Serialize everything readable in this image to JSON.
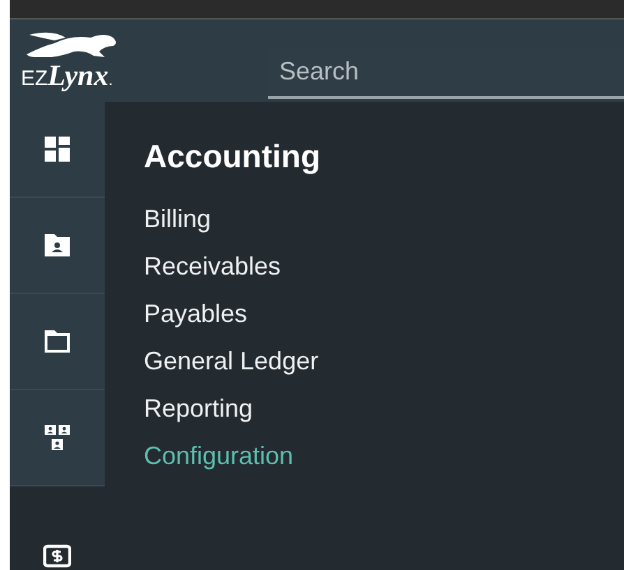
{
  "logo": {
    "prefix": "EZ",
    "name": "Lynx",
    "suffix": "."
  },
  "search": {
    "placeholder": "Search"
  },
  "rail": [
    {
      "kind": "dashboard",
      "selected": false
    },
    {
      "kind": "contact",
      "selected": false
    },
    {
      "kind": "folder",
      "selected": false
    },
    {
      "kind": "org",
      "selected": false
    },
    {
      "kind": "dollar",
      "selected": true
    }
  ],
  "menu": {
    "title": "Accounting",
    "items": [
      {
        "label": "Billing",
        "selected": false
      },
      {
        "label": "Receivables",
        "selected": false
      },
      {
        "label": "Payables",
        "selected": false
      },
      {
        "label": "General Ledger",
        "selected": false
      },
      {
        "label": "Reporting",
        "selected": false
      },
      {
        "label": "Configuration",
        "selected": true
      }
    ]
  }
}
